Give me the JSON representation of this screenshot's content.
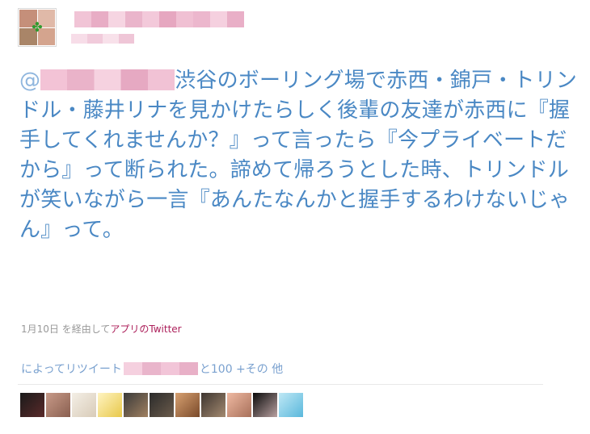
{
  "tweet": {
    "text": "渋谷のボーリング場で赤西・錦戸・トリンドル・藤井リナを見かけたらしく後輩の友達が赤西に『握手してくれませんか？』って言ったら『今プライベートだから』って断られた。諦めて帰ろうとした時、トリンドルが笑いながら一言『あんたなんかと握手するわけないじゃん』って。",
    "mention_prefix": "@"
  },
  "meta": {
    "date": "1月10日",
    "via": "を経由して",
    "app": "アプリのTwitter"
  },
  "retweet": {
    "prefix": "によってリツイート",
    "suffix": "と100 +その 他"
  },
  "colors": {
    "tweet_text": "#4a88c4",
    "link": "#ac1f5a",
    "meta": "#999999"
  },
  "icons": {
    "clover": "four-leaf-clover-icon"
  }
}
